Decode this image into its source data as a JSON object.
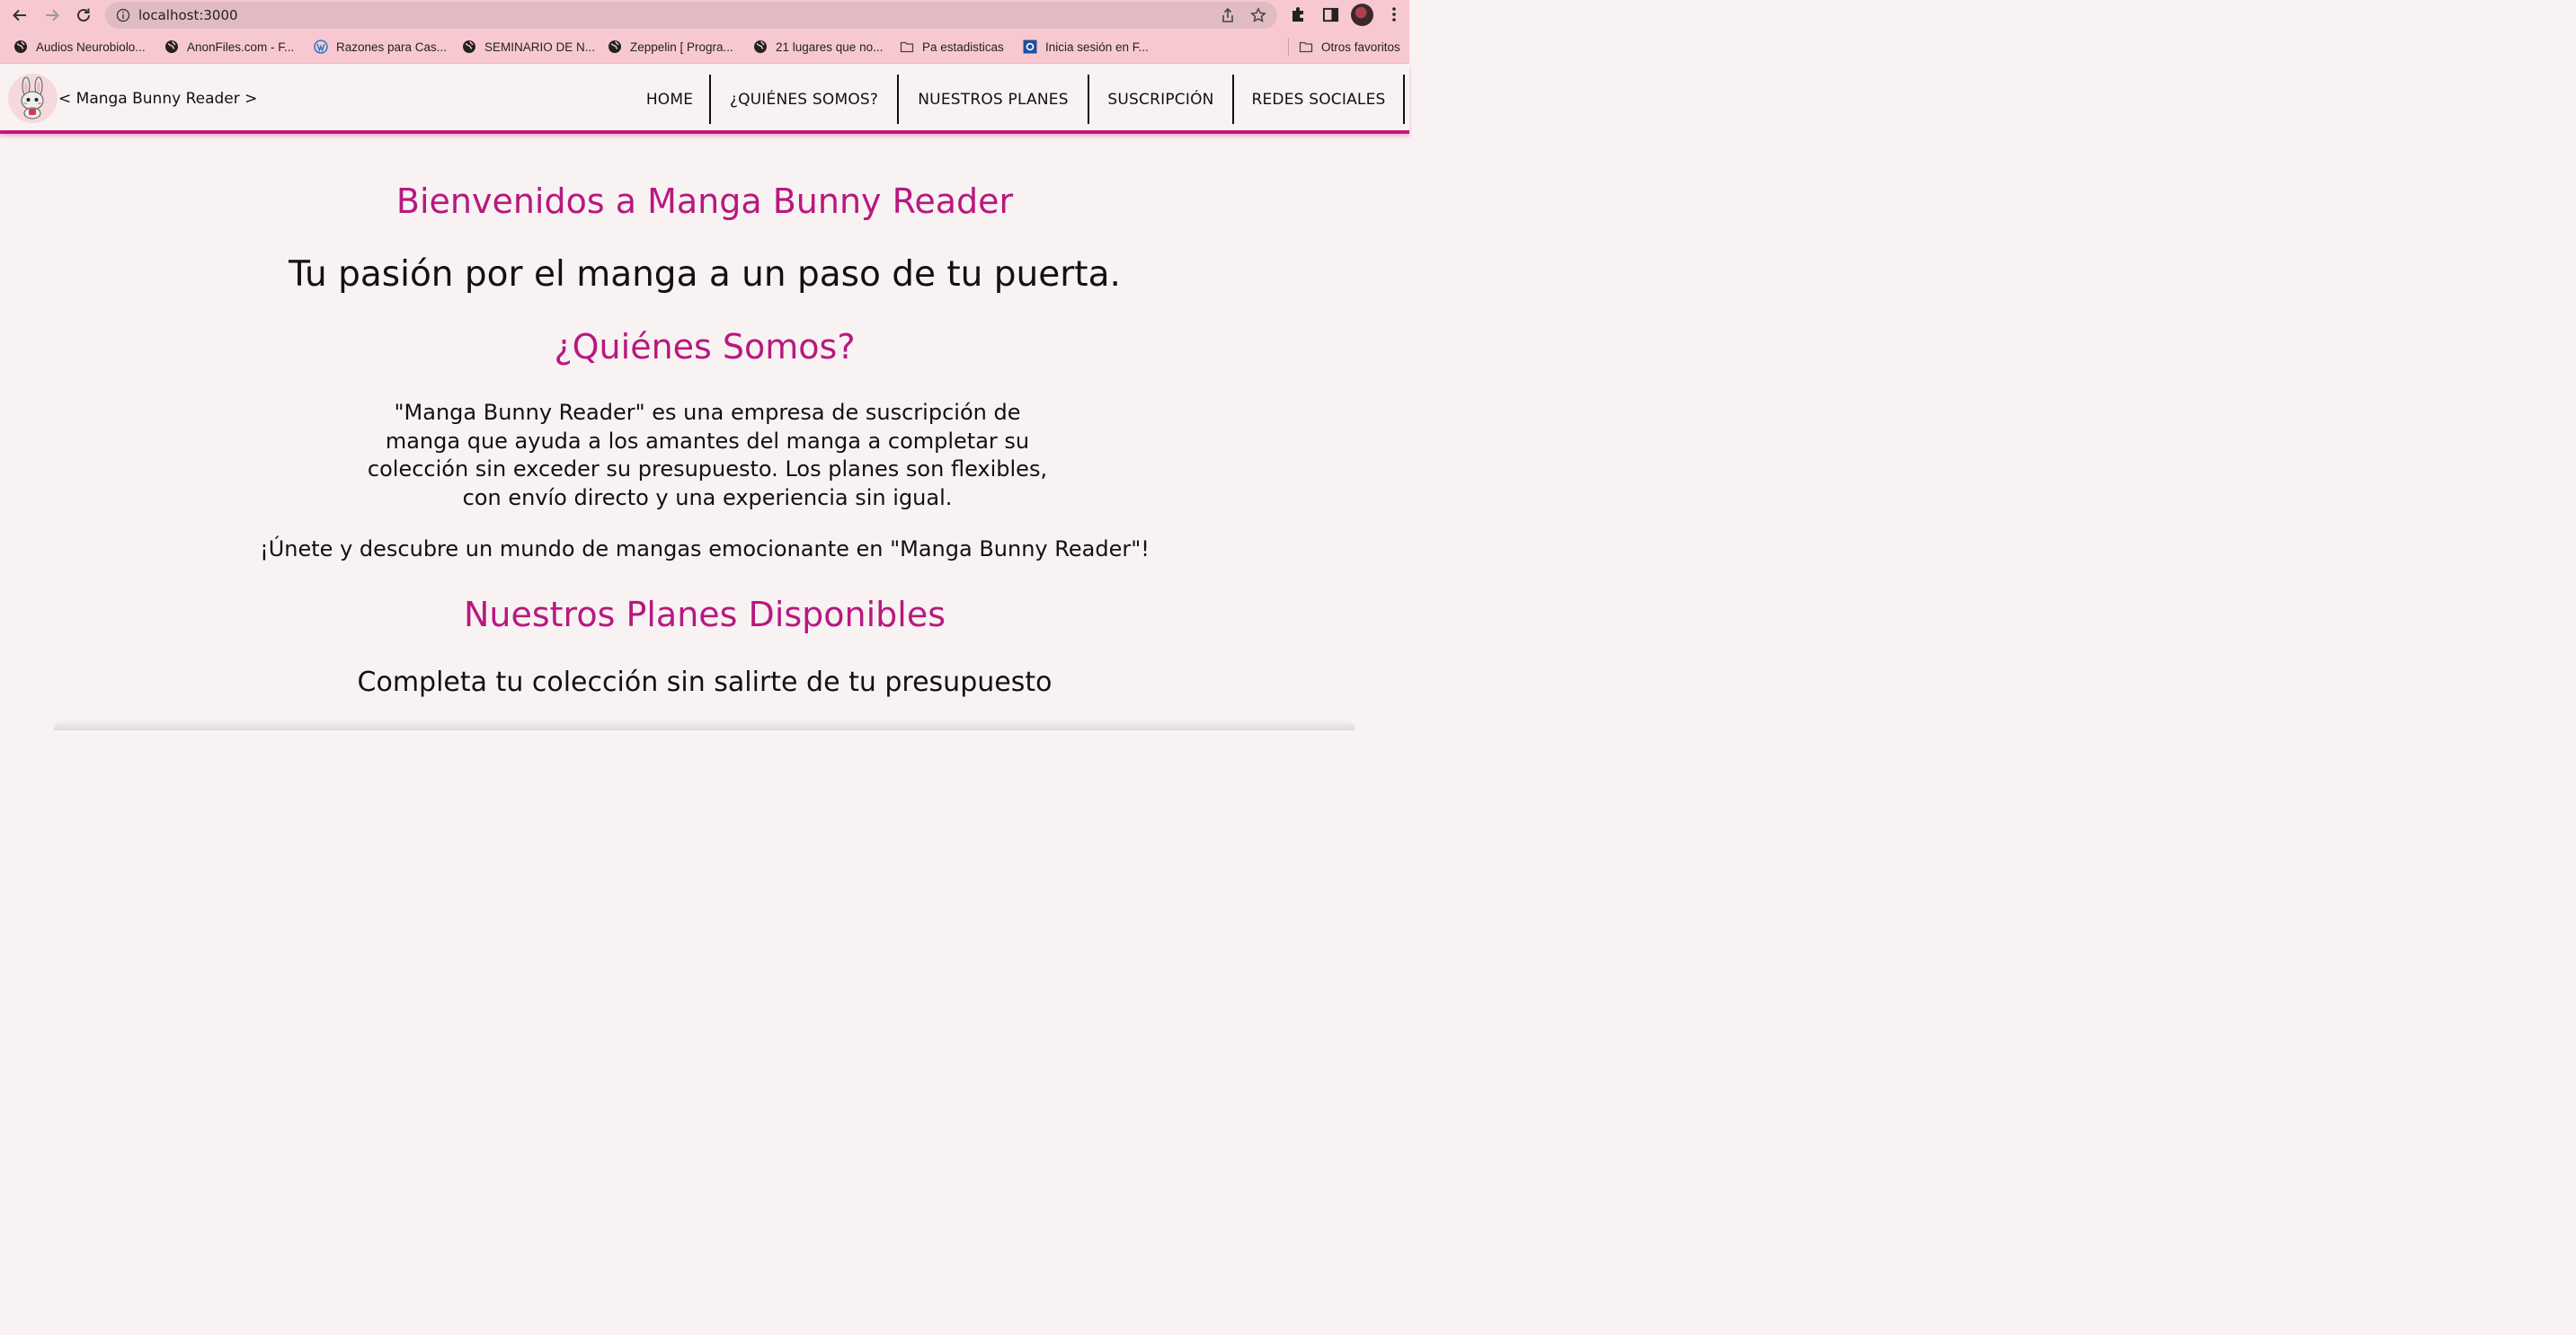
{
  "browser": {
    "url": "localhost:3000",
    "bookmarks": [
      {
        "label": "Audios Neurobiolo...",
        "icon": "globe-icon"
      },
      {
        "label": "AnonFiles.com - F...",
        "icon": "globe-icon"
      },
      {
        "label": "Razones para Cas...",
        "icon": "wordpress-icon"
      },
      {
        "label": "SEMINARIO DE N...",
        "icon": "globe-icon"
      },
      {
        "label": "Zeppelin [ Progra...",
        "icon": "globe-icon"
      },
      {
        "label": "21 lugares que no...",
        "icon": "globe-icon"
      },
      {
        "label": "Pa estadisticas",
        "icon": "folder-icon"
      },
      {
        "label": "Inicia sesión en F...",
        "icon": "site-icon"
      },
      {
        "label": "Otros favoritos",
        "icon": "folder-icon"
      }
    ]
  },
  "site": {
    "brand": "< Manga Bunny Reader >",
    "menu": [
      "HOME",
      "¿QUIÉNES SOMOS?",
      "NUESTROS PLANES",
      "SUSCRIPCIÓN",
      "REDES SOCIALES"
    ],
    "accent_color": "#b8187f"
  },
  "content": {
    "welcome": "Bienvenidos a Manga Bunny Reader",
    "tagline": "Tu pasión por el manga a un paso de tu puerta.",
    "about_title": "¿Quiénes Somos?",
    "about_text": "\"Manga Bunny Reader\" es una empresa de suscripción de manga que ayuda a los amantes del manga a completar su colección sin exceder su presupuesto. Los planes son flexibles, con envío directo y una experiencia sin igual.",
    "join_text": "¡Únete y descubre un mundo de mangas emocionante en \"Manga Bunny Reader\"!",
    "plans_title": "Nuestros Planes Disponibles",
    "plans_subtitle": "Completa tu colección sin salirte de tu presupuesto"
  }
}
